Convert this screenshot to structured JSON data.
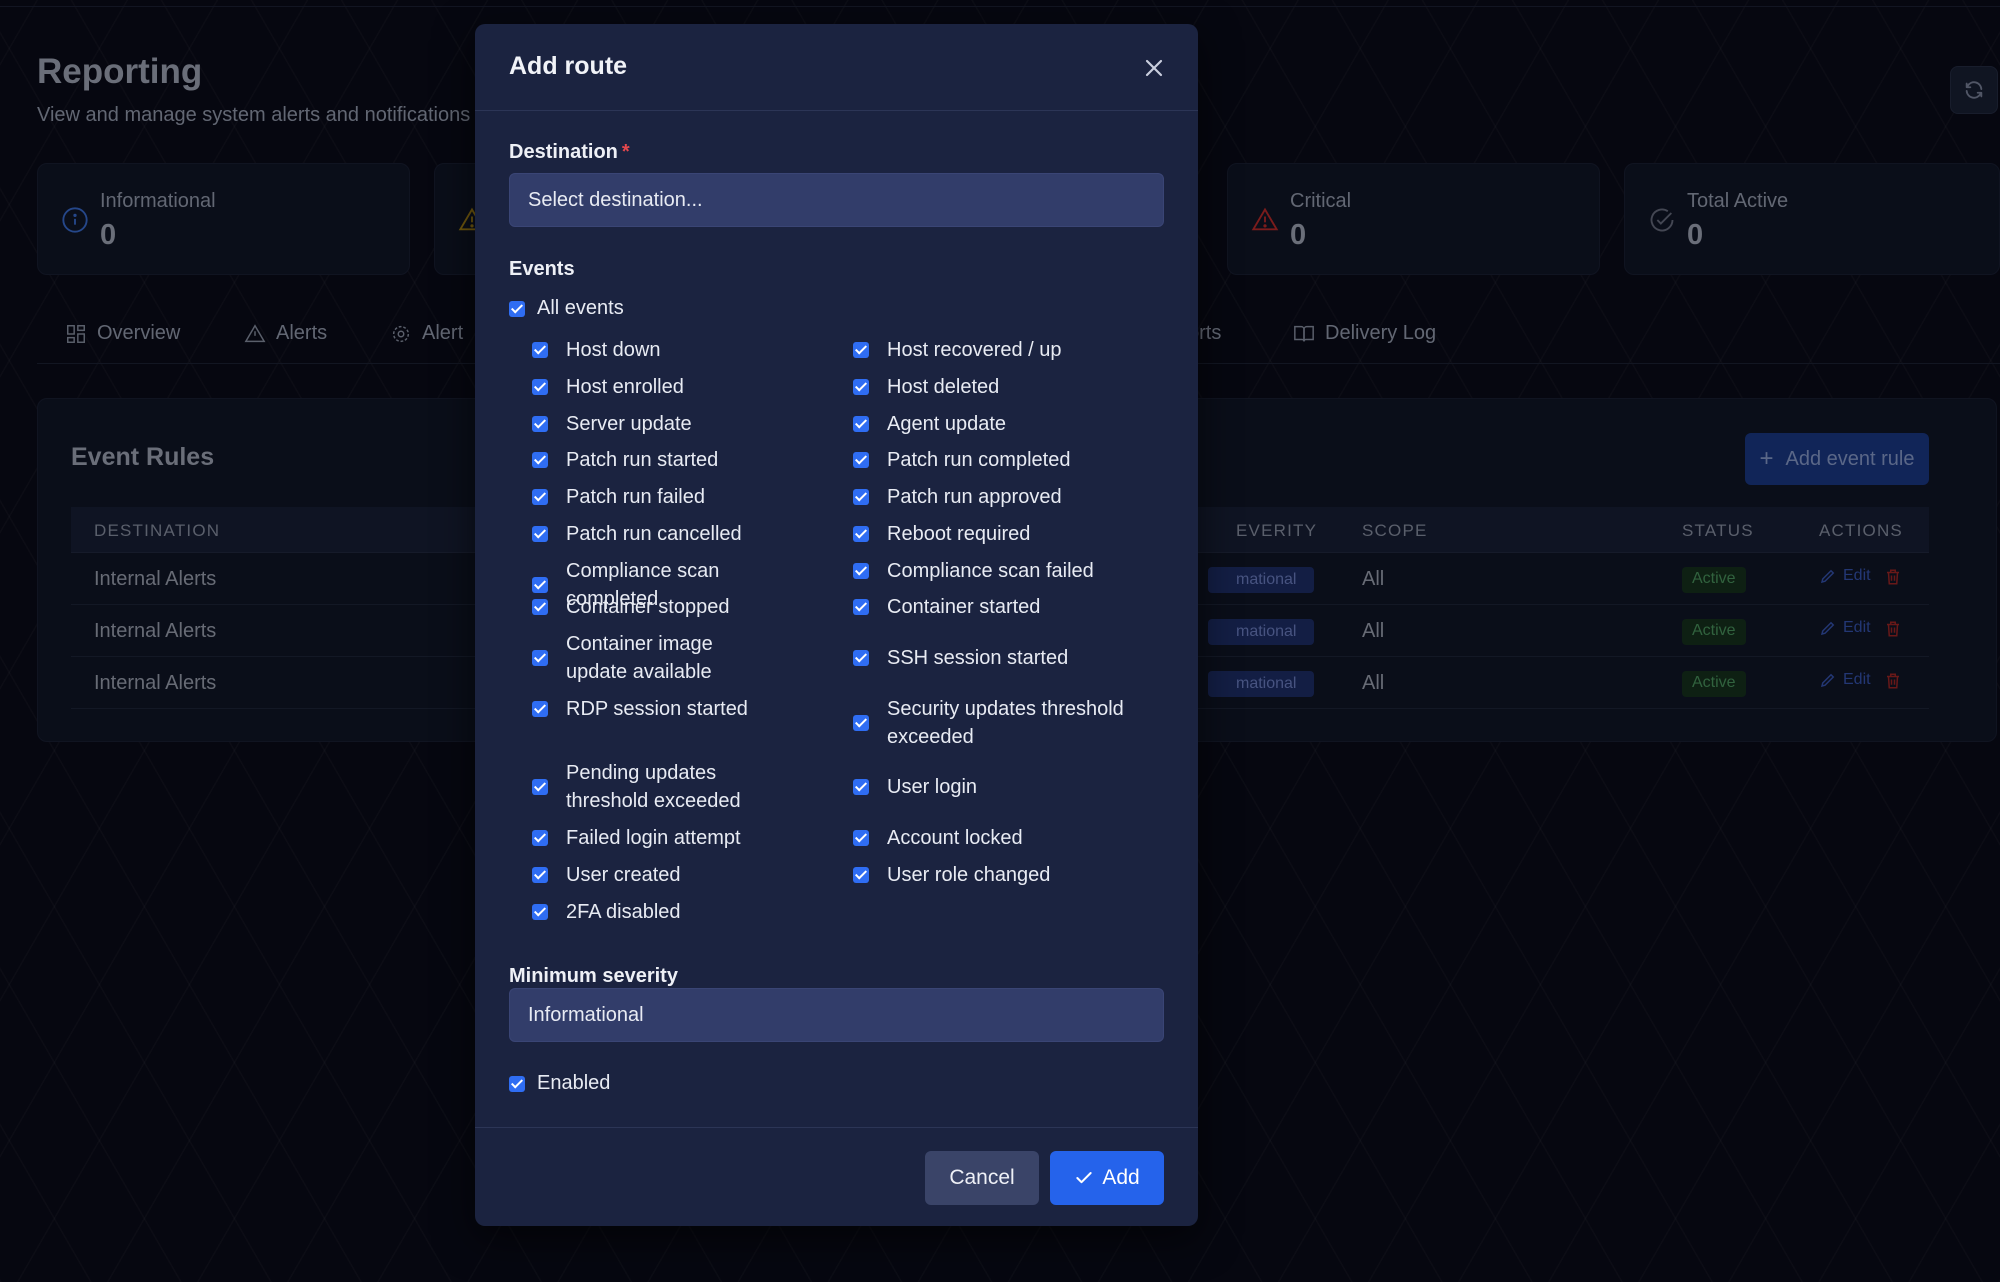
{
  "page": {
    "title": "Reporting",
    "subtitle": "View and manage system alerts and notifications"
  },
  "stats": [
    {
      "label": "Informational",
      "value": "0",
      "icon": "info-icon",
      "color": "#3b82f6"
    },
    {
      "label": "",
      "value": "",
      "icon": "warning-icon",
      "color": "#eab308"
    },
    {
      "label": "Critical",
      "value": "0",
      "icon": "alert-triangle-icon",
      "color": "#dc2626"
    },
    {
      "label": "Total Active",
      "value": "0",
      "icon": "check-circle-icon",
      "color": "#6b7280"
    }
  ],
  "tabs": [
    {
      "label": "Overview",
      "icon": "grid-icon"
    },
    {
      "label": "Alerts",
      "icon": "warning-icon"
    },
    {
      "label": "Alert",
      "icon": "gear-icon"
    },
    {
      "label": "orts",
      "icon": ""
    },
    {
      "label": "Delivery Log",
      "icon": "book-icon"
    }
  ],
  "event_rules": {
    "title": "Event Rules",
    "add_button": "Add event rule",
    "columns": {
      "destination": "DESTINATION",
      "severity": "EVERITY",
      "scope": "SCOPE",
      "status": "STATUS",
      "actions": "ACTIONS"
    },
    "rows": [
      {
        "destination": "Internal Alerts",
        "severity": "mational",
        "scope": "All",
        "status": "Active",
        "edit": "Edit"
      },
      {
        "destination": "Internal Alerts",
        "severity": "mational",
        "scope": "All",
        "status": "Active",
        "edit": "Edit"
      },
      {
        "destination": "Internal Alerts",
        "severity": "mational",
        "scope": "All",
        "status": "Active",
        "edit": "Edit"
      }
    ]
  },
  "modal": {
    "title": "Add route",
    "destination_label": "Destination",
    "required_mark": "*",
    "destination_value": "Select destination...",
    "events_label": "Events",
    "all_events_label": "All events",
    "events_left": [
      "Host down",
      "Host enrolled",
      "Server update",
      "Patch run started",
      "Patch run failed",
      "Patch run cancelled",
      "Compliance scan completed",
      "Container stopped",
      "Container image update available",
      "RDP session started",
      "Pending updates threshold exceeded",
      "Failed login attempt",
      "User created",
      "2FA disabled"
    ],
    "events_right": [
      "Host recovered / up",
      "Host deleted",
      "Agent update",
      "Patch run completed",
      "Patch run approved",
      "Reboot required",
      "Compliance scan failed",
      "Container started",
      "SSH session started",
      "Security updates threshold exceeded",
      "User login",
      "Account locked",
      "User role changed"
    ],
    "min_severity_label": "Minimum severity",
    "min_severity_value": "Informational",
    "enabled_label": "Enabled",
    "cancel_label": "Cancel",
    "add_label": "Add"
  }
}
